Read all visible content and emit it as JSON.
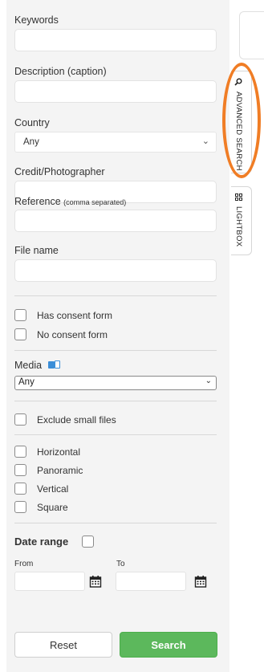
{
  "fields": {
    "keywords_label": "Keywords",
    "description_label": "Description (caption)",
    "country_label": "Country",
    "country_value": "Any",
    "credit_label": "Credit/Photographer",
    "reference_label": "Reference",
    "reference_hint": "(comma separated)",
    "filename_label": "File name"
  },
  "consent": {
    "has": "Has consent form",
    "no": "No consent form"
  },
  "media": {
    "label": "Media",
    "value": "Any"
  },
  "exclude_small": "Exclude small files",
  "orientation": [
    "Horizontal",
    "Panoramic",
    "Vertical",
    "Square"
  ],
  "date": {
    "label": "Date range",
    "from": "From",
    "to": "To"
  },
  "buttons": {
    "reset": "Reset",
    "search": "Search"
  },
  "tabs": {
    "advanced_search": "ADVANCED SEARCH",
    "lightbox": "LIGHTBOX",
    "advanced_search_icon": "search-icon",
    "lightbox_icon": "grid-icon"
  },
  "colors": {
    "search_button": "#5cb85c",
    "highlight": "#f07d25",
    "media_info_icon": "#3b8ed8"
  }
}
